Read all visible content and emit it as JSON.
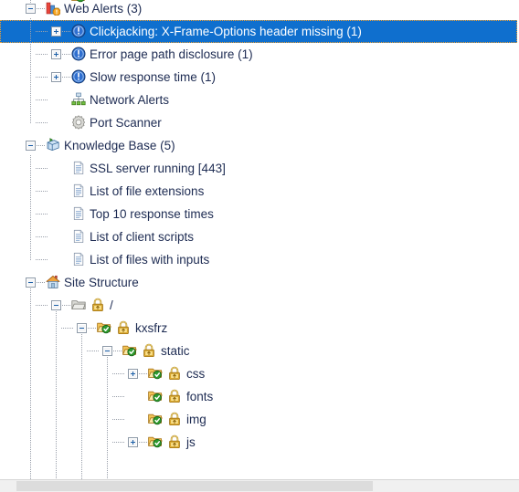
{
  "app": {
    "panel_name": "scan-results-tree",
    "selection_color": "#0f6fce",
    "selection_text_color": "#ffffff",
    "text_color": "#1d2b52"
  },
  "tree": {
    "nodes": [
      {
        "id": "web-alerts",
        "label": "Web Alerts (3)",
        "icon": "bar-chart-alert-icon",
        "depth": 0,
        "expander": "minus",
        "selected": false
      },
      {
        "id": "clickjacking",
        "label": "Clickjacking: X-Frame-Options header missing (1)",
        "icon": "alert-info-icon",
        "depth": 1,
        "expander": "plus",
        "selected": true
      },
      {
        "id": "error-page-path-disclosure",
        "label": "Error page path disclosure (1)",
        "icon": "alert-info-icon",
        "depth": 1,
        "expander": "plus",
        "selected": false
      },
      {
        "id": "slow-response-time",
        "label": "Slow response time (1)",
        "icon": "alert-info-icon",
        "depth": 1,
        "expander": "plus",
        "selected": false
      },
      {
        "id": "network-alerts",
        "label": "Network Alerts",
        "icon": "network-icon",
        "depth": 1,
        "expander": "none",
        "selected": false
      },
      {
        "id": "port-scanner",
        "label": "Port Scanner",
        "icon": "gear-icon",
        "depth": 1,
        "expander": "none",
        "selected": false
      },
      {
        "id": "knowledge-base",
        "label": "Knowledge Base (5)",
        "icon": "knowledge-book-icon",
        "depth": 0,
        "expander": "minus",
        "selected": false
      },
      {
        "id": "ssl-server-running",
        "label": "SSL server running [443]",
        "icon": "document-icon",
        "depth": 1,
        "expander": "none",
        "selected": false
      },
      {
        "id": "list-of-file-extensions",
        "label": "List of file extensions",
        "icon": "document-icon",
        "depth": 1,
        "expander": "none",
        "selected": false
      },
      {
        "id": "top-10-response-times",
        "label": "Top 10 response times",
        "icon": "document-icon",
        "depth": 1,
        "expander": "none",
        "selected": false
      },
      {
        "id": "list-of-client-scripts",
        "label": "List of client scripts",
        "icon": "document-icon",
        "depth": 1,
        "expander": "none",
        "selected": false
      },
      {
        "id": "list-of-files-with-inputs",
        "label": "List of files with inputs",
        "icon": "document-icon",
        "depth": 1,
        "expander": "none",
        "selected": false
      },
      {
        "id": "site-structure",
        "label": "Site Structure",
        "icon": "house-icon",
        "depth": 0,
        "expander": "minus",
        "selected": false
      },
      {
        "id": "root",
        "label": "/",
        "icon": "folder-gray-icon",
        "icon2": "padlock-icon",
        "depth": 1,
        "expander": "minus",
        "selected": false
      },
      {
        "id": "kxsfrz",
        "label": "kxsfrz",
        "icon": "folder-checked-icon",
        "icon2": "padlock-icon",
        "depth": 2,
        "expander": "minus",
        "selected": false
      },
      {
        "id": "static",
        "label": "static",
        "icon": "folder-checked-icon",
        "icon2": "padlock-icon",
        "depth": 3,
        "expander": "minus",
        "selected": false
      },
      {
        "id": "css",
        "label": "css",
        "icon": "folder-checked-icon",
        "icon2": "padlock-icon",
        "depth": 4,
        "expander": "plus",
        "selected": false
      },
      {
        "id": "fonts",
        "label": "fonts",
        "icon": "folder-checked-icon",
        "icon2": "padlock-icon",
        "depth": 4,
        "expander": "none",
        "selected": false
      },
      {
        "id": "img",
        "label": "img",
        "icon": "folder-checked-icon",
        "icon2": "padlock-icon",
        "depth": 4,
        "expander": "none",
        "selected": false
      },
      {
        "id": "js",
        "label": "js",
        "icon": "folder-checked-icon",
        "icon2": "padlock-icon",
        "depth": 4,
        "expander": "plus",
        "selected": false
      }
    ]
  },
  "scrollbar": {
    "orientation": "horizontal",
    "name": "horizontal-scrollbar"
  }
}
